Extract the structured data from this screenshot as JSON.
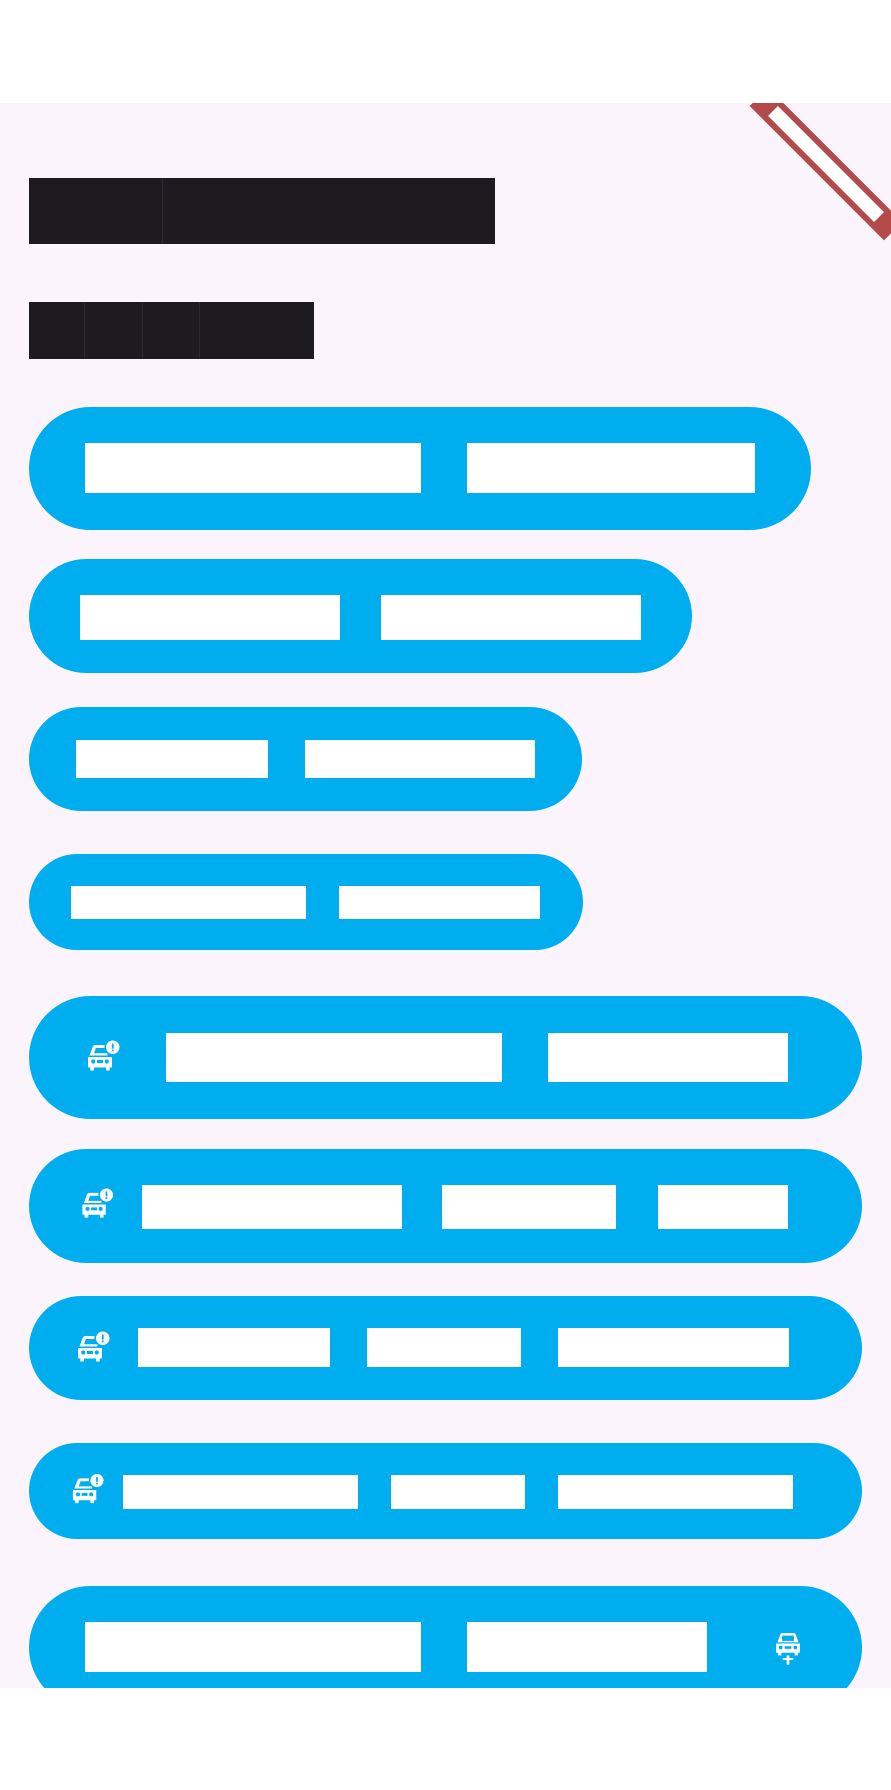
{
  "app": {
    "background": "#fcf4fc",
    "accent": "#00aeef",
    "heading_color": "#1d1b20",
    "debug_banner": {
      "label": "",
      "color": "#b34a4a"
    }
  },
  "headings": [
    {
      "name": "title",
      "text": ""
    },
    {
      "name": "subtitle",
      "text": ""
    }
  ],
  "buttons": [
    {
      "name": "pill-button-1",
      "icon": "",
      "icon_position": "",
      "labels": [
        "",
        ""
      ]
    },
    {
      "name": "pill-button-2",
      "icon": "",
      "icon_position": "",
      "labels": [
        "",
        ""
      ]
    },
    {
      "name": "pill-button-3",
      "icon": "",
      "icon_position": "",
      "labels": [
        "",
        ""
      ]
    },
    {
      "name": "pill-button-4",
      "icon": "",
      "icon_position": "",
      "labels": [
        "",
        ""
      ]
    },
    {
      "name": "pill-button-5",
      "icon": "car-alert-icon",
      "icon_position": "leading",
      "labels": [
        "",
        ""
      ]
    },
    {
      "name": "pill-button-6",
      "icon": "car-alert-icon",
      "icon_position": "leading",
      "labels": [
        "",
        "",
        ""
      ]
    },
    {
      "name": "pill-button-7",
      "icon": "car-alert-icon",
      "icon_position": "leading",
      "labels": [
        "",
        "",
        ""
      ]
    },
    {
      "name": "pill-button-8",
      "icon": "car-alert-icon",
      "icon_position": "leading",
      "labels": [
        "",
        "",
        ""
      ]
    },
    {
      "name": "pill-button-9",
      "icon": "car-rental-icon",
      "icon_position": "trailing",
      "labels": [
        "",
        ""
      ]
    }
  ]
}
